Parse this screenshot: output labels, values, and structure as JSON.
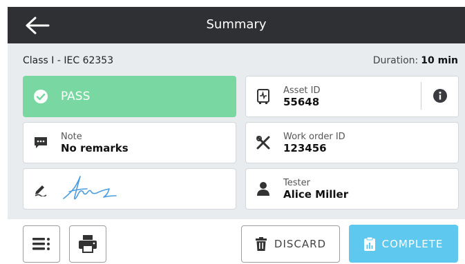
{
  "header": {
    "title": "Summary",
    "back_icon": "arrow-left-icon"
  },
  "subheader": {
    "test_class": "Class I - IEC 62353",
    "duration_label": "Duration:",
    "duration_value": "10 min"
  },
  "result": {
    "status": "PASS",
    "color": "#79d8a1"
  },
  "asset": {
    "label": "Asset ID",
    "value": "55648"
  },
  "note": {
    "label": "Note",
    "value": "No remarks"
  },
  "work_order": {
    "label": "Work order ID",
    "value": "123456"
  },
  "tester": {
    "label": "Tester",
    "value": "Alice Miller"
  },
  "signature": {
    "icon": "pen-icon"
  },
  "footer": {
    "discard_label": "DISCARD",
    "complete_label": "COMPLETE",
    "complete_color": "#5ec8ef"
  }
}
